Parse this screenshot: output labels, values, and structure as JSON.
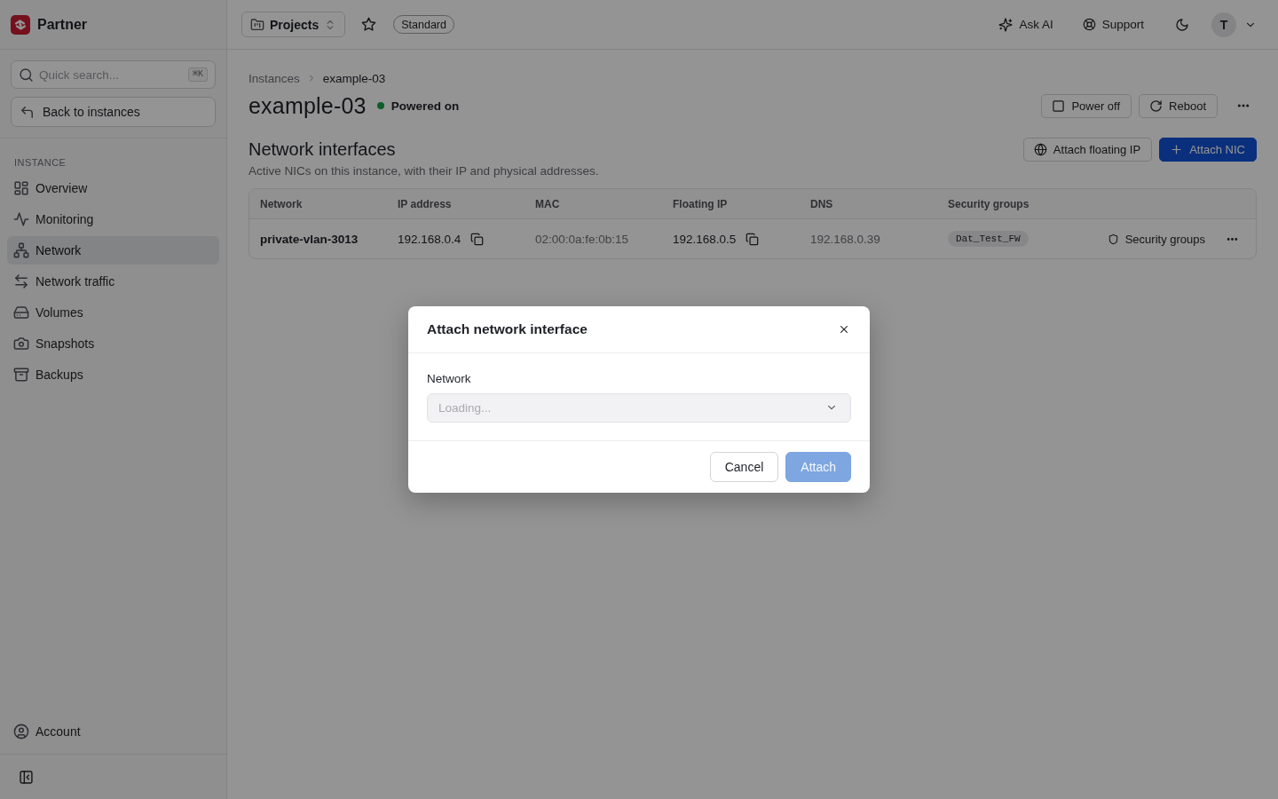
{
  "sidebar": {
    "brand": "Partner",
    "search": {
      "placeholder": "Quick search...",
      "shortcut": "⌘K"
    },
    "back_button": "Back to instances",
    "section_label": "INSTANCE",
    "items": [
      {
        "label": "Overview",
        "selected": false
      },
      {
        "label": "Monitoring",
        "selected": false
      },
      {
        "label": "Network",
        "selected": true
      },
      {
        "label": "Network traffic",
        "selected": false
      },
      {
        "label": "Volumes",
        "selected": false
      },
      {
        "label": "Snapshots",
        "selected": false
      },
      {
        "label": "Backups",
        "selected": false
      }
    ],
    "account": "Account"
  },
  "topbar": {
    "project_selector": "Projects",
    "plan_badge": "Standard",
    "ask_ai": "Ask AI",
    "support": "Support",
    "avatar": "T"
  },
  "breadcrumbs": [
    "Instances",
    "example-03"
  ],
  "instance": {
    "name": "example-03",
    "running": true,
    "status": "Powered on",
    "actions": [
      "Power off",
      "Reboot"
    ]
  },
  "network_interfaces": {
    "title": "Network interfaces",
    "description": "Active NICs on this instance, with their IP and physical addresses.",
    "buttons": [
      {
        "label": "Attach floating IP",
        "kind": "secondary"
      },
      {
        "label": "Attach NIC",
        "kind": "primary"
      }
    ]
  },
  "table": {
    "columns": [
      "Network",
      "IP address",
      "MAC",
      "Floating IP",
      "DNS",
      "Security groups"
    ],
    "rows": [
      {
        "network": "private-vlan-3013",
        "ip_address": "192.168.0.4",
        "mac": "02:00:0a:fe:0b:15",
        "floating_ip": "192.168.0.5",
        "dns": "192.168.0.39",
        "security_groups": [
          "Dat_Test_FW"
        ],
        "action": "Security groups"
      }
    ]
  },
  "dialog": {
    "title": "Attach network interface",
    "field_label": "Network",
    "select": {
      "placeholder": "Loading...",
      "disabled": true
    },
    "buttons": [
      {
        "label": "Cancel",
        "kind": "secondary",
        "disabled": false
      },
      {
        "label": "Attach",
        "kind": "primary",
        "disabled": true
      }
    ]
  }
}
